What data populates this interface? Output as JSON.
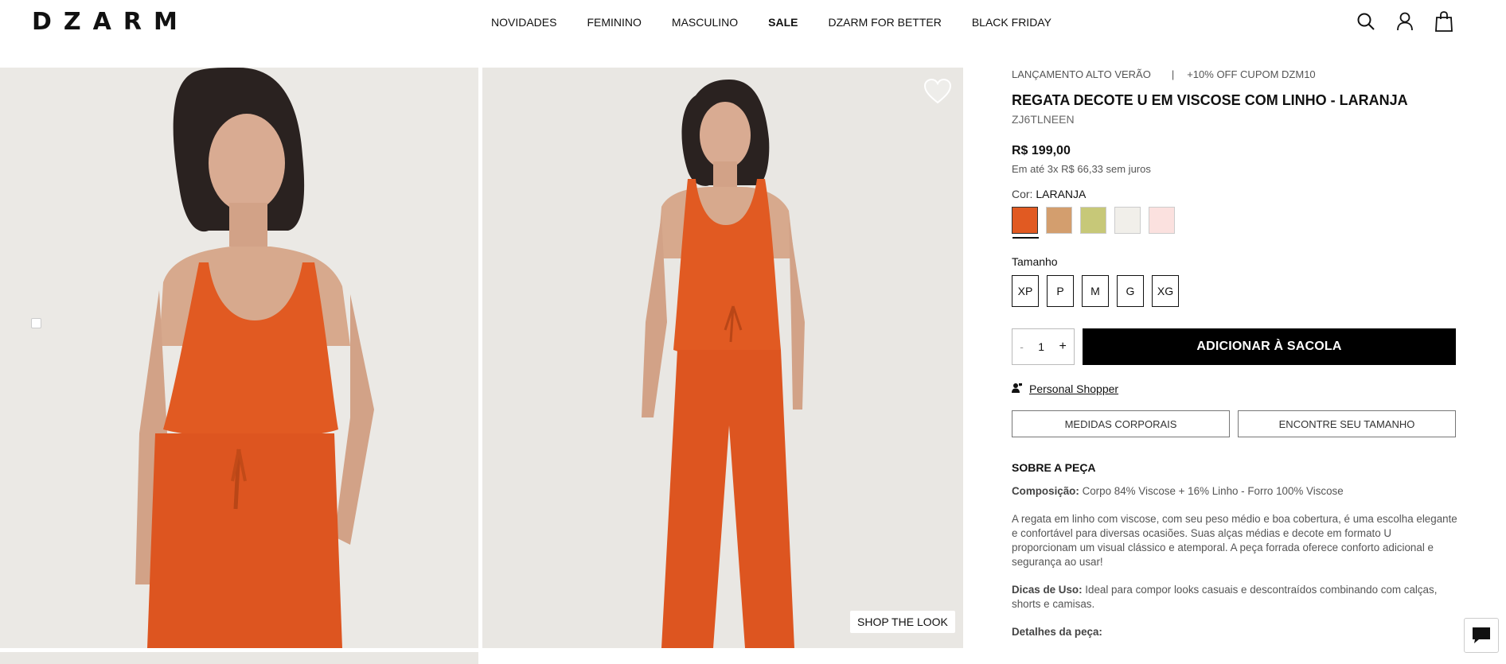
{
  "brand": {
    "logo": "DZARM"
  },
  "nav": [
    {
      "label": "NOVIDADES"
    },
    {
      "label": "FEMININO"
    },
    {
      "label": "MASCULINO"
    },
    {
      "label": "SALE"
    },
    {
      "label": "DZARM FOR BETTER"
    },
    {
      "label": "BLACK FRIDAY"
    }
  ],
  "header_icons": [
    "search-icon",
    "user-icon",
    "bag-icon"
  ],
  "gallery": {
    "shop_the_look": "SHOP THE LOOK",
    "product_color": "#e15a22",
    "background": "#e9e7e3"
  },
  "product": {
    "tag_1": "LANÇAMENTO ALTO VERÃO",
    "tag_sep": "|",
    "tag_2": "+10% OFF CUPOM DZM10",
    "title": "REGATA DECOTE U EM VISCOSE COM LINHO - LARANJA",
    "sku": "ZJ6TLNEEN",
    "price": "R$ 199,00",
    "installments": "Em até 3x R$ 66,33 sem juros",
    "color_label": "Cor:",
    "color_value": "LARANJA",
    "swatches": [
      "#e15a22",
      "#d39e6e",
      "#c7c878",
      "#f1efea",
      "#fbe1df"
    ],
    "size_label": "Tamanho",
    "sizes": [
      "XP",
      "P",
      "M",
      "G",
      "XG"
    ],
    "qty_minus": "-",
    "qty": "1",
    "qty_plus": "+",
    "add_to_bag": "ADICIONAR À SACOLA",
    "personal_shopper": "Personal Shopper",
    "measures_button": "MEDIDAS CORPORAIS",
    "find_size_button": "ENCONTRE SEU TAMANHO",
    "about_title": "SOBRE A PEÇA",
    "composition_label": "Composição:",
    "composition": "Corpo 84% Viscose + 16% Linho - Forro 100% Viscose",
    "description": "A regata em linho com viscose, com seu peso médio e boa cobertura, é uma escolha elegante e confortável para diversas ocasiões. Suas alças médias e decote em formato U proporcionam um visual clássico e atemporal. A peça forrada oferece conforto adicional e segurança ao usar!",
    "tips_label": "Dicas de Uso:",
    "tips": "Ideal para compor looks casuais e descontraídos combinando com calças, shorts e camisas.",
    "details_label": "Detalhes da peça:"
  }
}
